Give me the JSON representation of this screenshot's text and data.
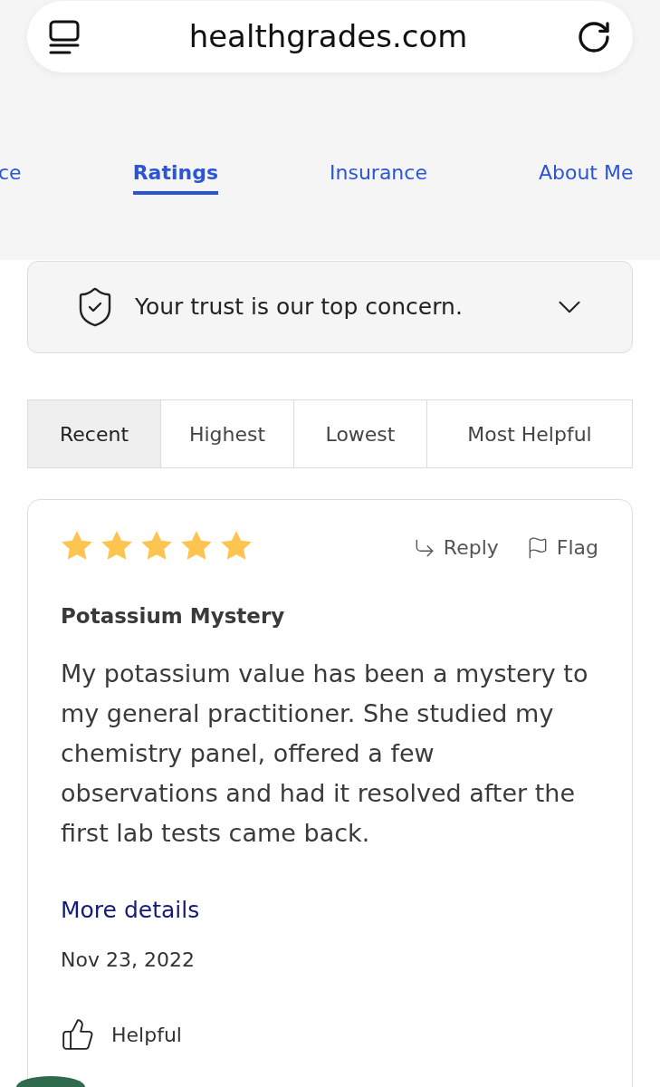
{
  "browser": {
    "url": "healthgrades.com"
  },
  "nav_tabs": [
    {
      "label": "ce",
      "selected": false
    },
    {
      "label": "Ratings",
      "selected": true
    },
    {
      "label": "Insurance",
      "selected": false
    },
    {
      "label": "About Me",
      "selected": false
    }
  ],
  "trust_banner": {
    "text": "Your trust is our top concern.",
    "expanded": false
  },
  "sort_tabs": [
    {
      "label": "Recent",
      "selected": true
    },
    {
      "label": "Highest",
      "selected": false
    },
    {
      "label": "Lowest",
      "selected": false
    },
    {
      "label": "Most Helpful",
      "selected": false
    }
  ],
  "review": {
    "stars": 5,
    "actions": [
      {
        "kind": "reply",
        "label": "Reply"
      },
      {
        "kind": "flag",
        "label": "Flag"
      }
    ],
    "title": "Potassium Mystery",
    "body": "My potassium value has been a mystery to my general practitioner. She studied my chemistry panel, offered a few observations and had it resolved after the first lab tests came back.",
    "more_link": "More details",
    "date": "Nov 23, 2022",
    "helpful": "Helpful"
  }
}
